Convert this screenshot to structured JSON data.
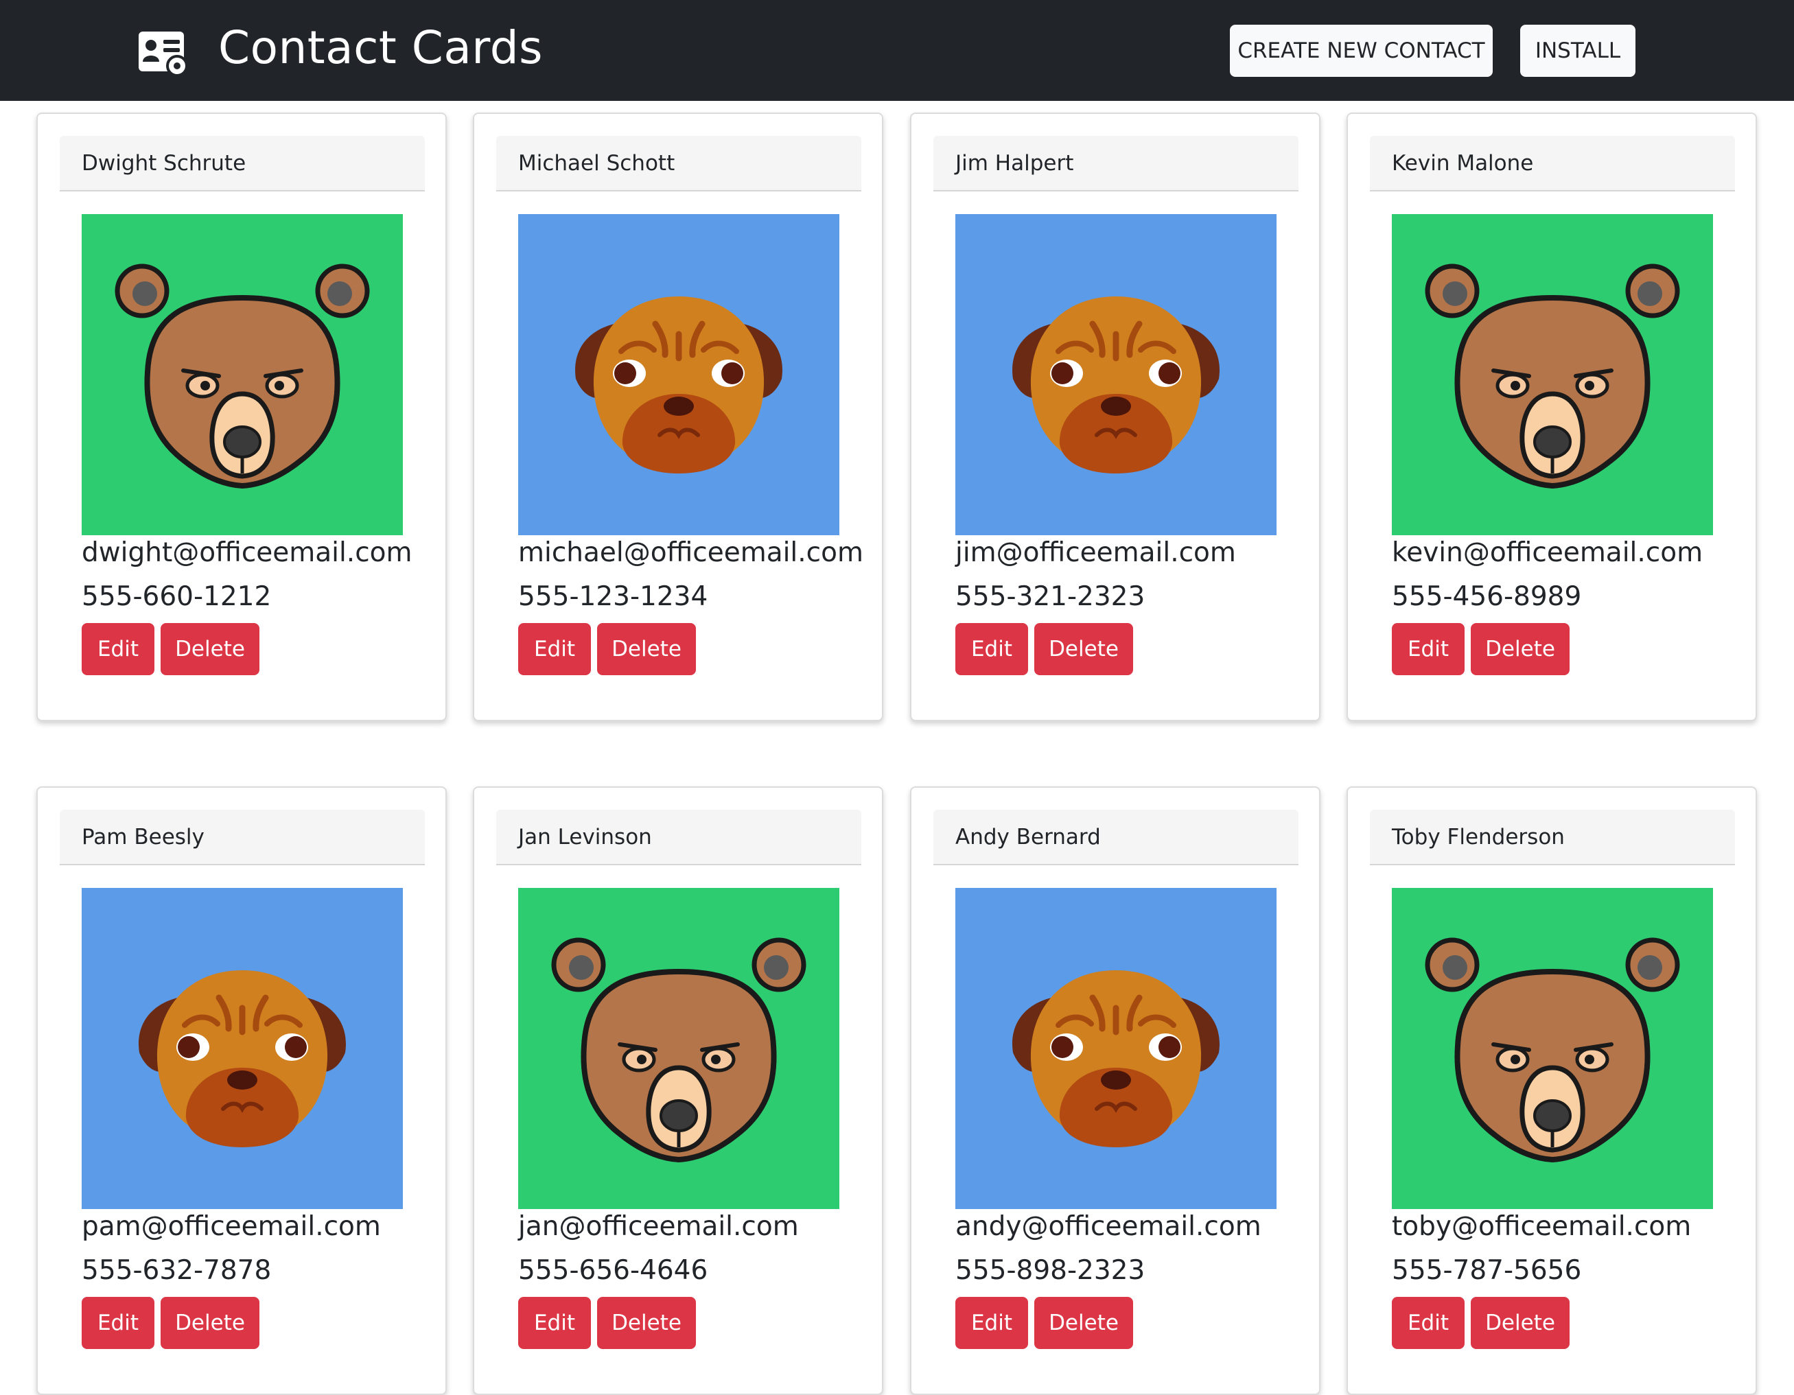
{
  "header": {
    "title": "Contact Cards",
    "create_label": "CREATE NEW CONTACT",
    "install_label": "INSTALL"
  },
  "colors": {
    "navbar": "#212529",
    "danger": "#dc3545",
    "avatar_green": "#2ecc71",
    "avatar_blue": "#5b9be8"
  },
  "buttons": {
    "edit_label": "Edit",
    "delete_label": "Delete"
  },
  "contacts": [
    {
      "name": "Dwight Schrute",
      "email": "dwight@officeemail.com",
      "phone": "555-660-1212",
      "avatar": "bear-icon"
    },
    {
      "name": "Michael Schott",
      "email": "michael@officeemail.com",
      "phone": "555-123-1234",
      "avatar": "pug-icon"
    },
    {
      "name": "Jim Halpert",
      "email": "jim@officeemail.com",
      "phone": "555-321-2323",
      "avatar": "pug-icon"
    },
    {
      "name": "Kevin Malone",
      "email": "kevin@officeemail.com",
      "phone": "555-456-8989",
      "avatar": "bear-icon"
    },
    {
      "name": "Pam Beesly",
      "email": "pam@officeemail.com",
      "phone": "555-632-7878",
      "avatar": "pug-icon"
    },
    {
      "name": "Jan Levinson",
      "email": "jan@officeemail.com",
      "phone": "555-656-4646",
      "avatar": "bear-icon"
    },
    {
      "name": "Andy Bernard",
      "email": "andy@officeemail.com",
      "phone": "555-898-2323",
      "avatar": "pug-icon"
    },
    {
      "name": "Toby Flenderson",
      "email": "toby@officeemail.com",
      "phone": "555-787-5656",
      "avatar": "bear-icon"
    }
  ]
}
